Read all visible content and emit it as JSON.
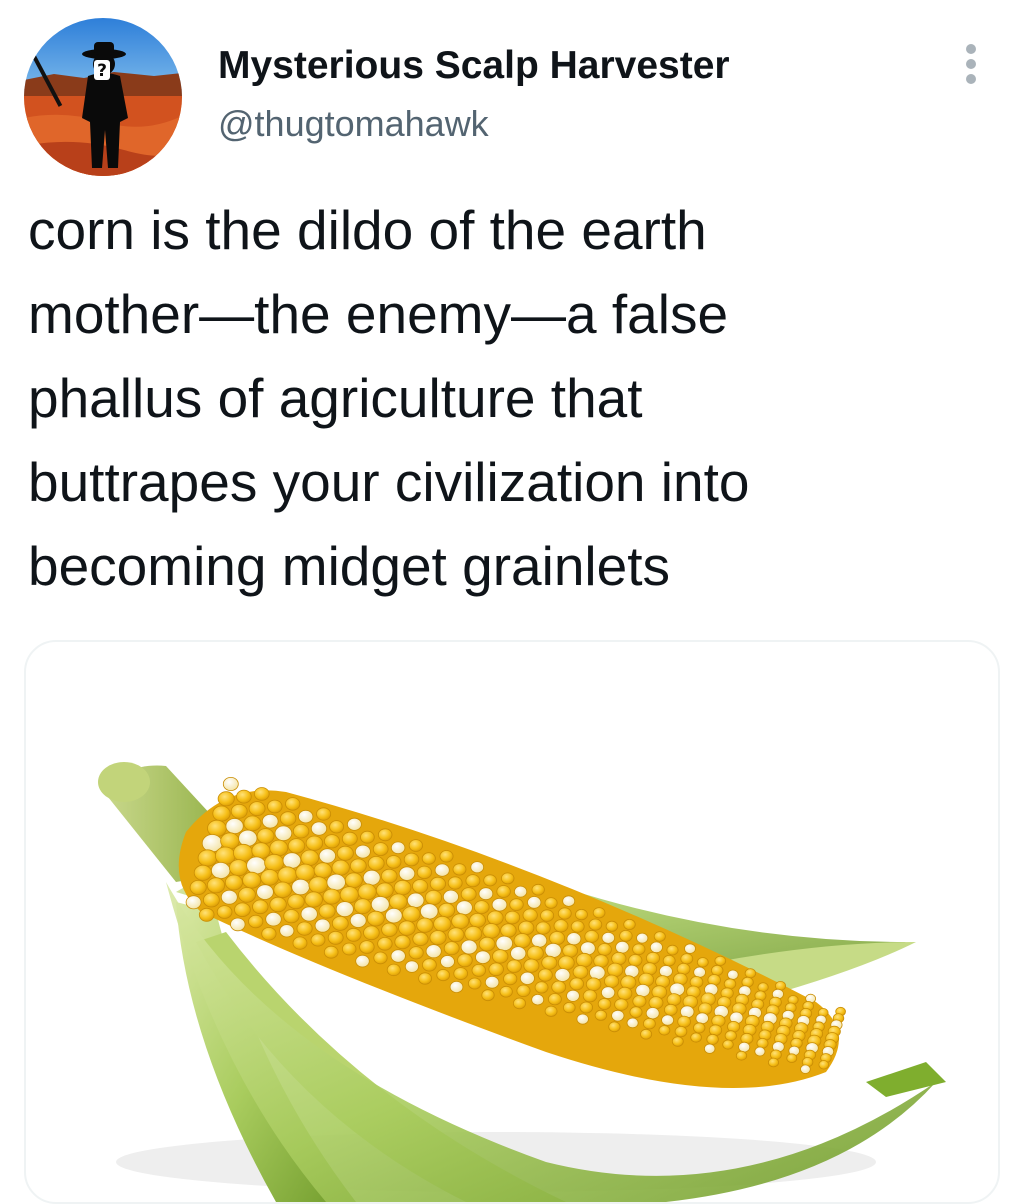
{
  "tweet": {
    "author": {
      "display_name": "Mysterious Scalp Harvester",
      "handle": "@thugtomahawk",
      "avatar_icon": "silhouette-cowboy-desert-avatar"
    },
    "more_icon": "vertical-ellipsis-icon",
    "text": "corn is the dildo of the earth\nmother—the enemy—a false\nphallus of agriculture that\nbuttrapes your civilization into\nbecoming midget grainlets",
    "media": {
      "subject": "corn-cob-photo"
    }
  },
  "colors": {
    "text_primary": "#0f1419",
    "text_secondary": "#536471",
    "card_border": "#eff3f4",
    "kernel_yellow": "#f6bf17",
    "kernel_white": "#fdf3c4",
    "husk_green": "#a9cc5e"
  }
}
